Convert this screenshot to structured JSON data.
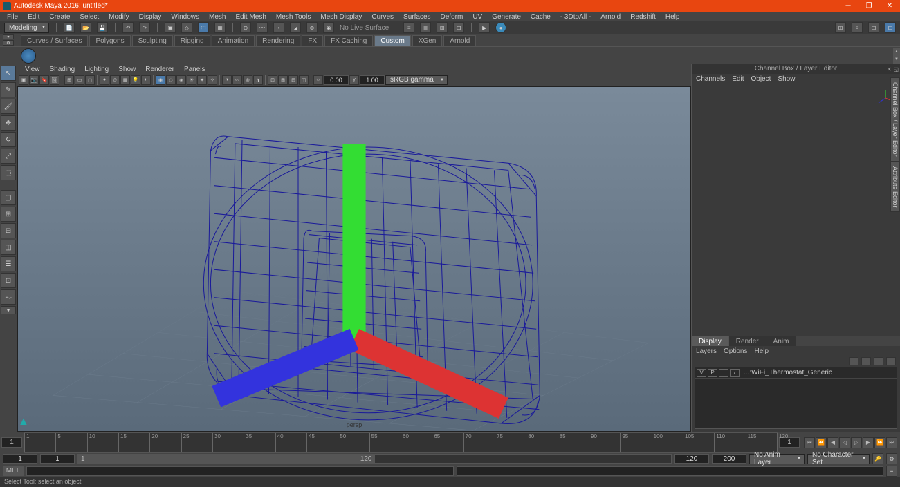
{
  "title": "Autodesk Maya 2016: untitled*",
  "menus": [
    "File",
    "Edit",
    "Create",
    "Select",
    "Modify",
    "Display",
    "Windows",
    "Mesh",
    "Edit Mesh",
    "Mesh Tools",
    "Mesh Display",
    "Curves",
    "Surfaces",
    "Deform",
    "UV",
    "Generate",
    "Cache",
    "- 3DtoAll -",
    "Arnold",
    "Redshift",
    "Help"
  ],
  "workspace": "Modeling",
  "status_text": "No Live Surface",
  "shelf_tabs": [
    "Curves / Surfaces",
    "Polygons",
    "Sculpting",
    "Rigging",
    "Animation",
    "Rendering",
    "FX",
    "FX Caching",
    "Custom",
    "XGen",
    "Arnold"
  ],
  "active_shelf": "Custom",
  "panel_menus": [
    "View",
    "Shading",
    "Lighting",
    "Show",
    "Renderer",
    "Panels"
  ],
  "exposure": "0.00",
  "gamma": "1.00",
  "color_space": "sRGB gamma",
  "camera": "persp",
  "channel_title": "Channel Box / Layer Editor",
  "channel_menus": [
    "Channels",
    "Edit",
    "Object",
    "Show"
  ],
  "layer_tabs": [
    "Display",
    "Render",
    "Anim"
  ],
  "active_layer_tab": "Display",
  "layer_menus": [
    "Layers",
    "Options",
    "Help"
  ],
  "layer_row": {
    "v": "V",
    "p": "P",
    "slash": "/",
    "name": "...:WiFi_Thermostat_Generic"
  },
  "side_tabs": [
    "Channel Box / Layer Editor",
    "Attribute Editor"
  ],
  "time_start": "1",
  "time_end": "120",
  "range_start": "1",
  "range_end": "120",
  "range_outer_start": "1",
  "range_outer_end": "200",
  "anim_layer": "No Anim Layer",
  "char_set": "No Character Set",
  "cmd_lang": "MEL",
  "help_text": "Select Tool: select an object",
  "ticks": [
    "1",
    "5",
    "10",
    "15",
    "20",
    "25",
    "30",
    "35",
    "40",
    "45",
    "50",
    "55",
    "60",
    "65",
    "70",
    "75",
    "80",
    "85",
    "90",
    "95",
    "100",
    "105",
    "110",
    "115",
    "120"
  ],
  "top_icons_right": [
    "⊞",
    "≡",
    "⊡",
    "⊟"
  ]
}
